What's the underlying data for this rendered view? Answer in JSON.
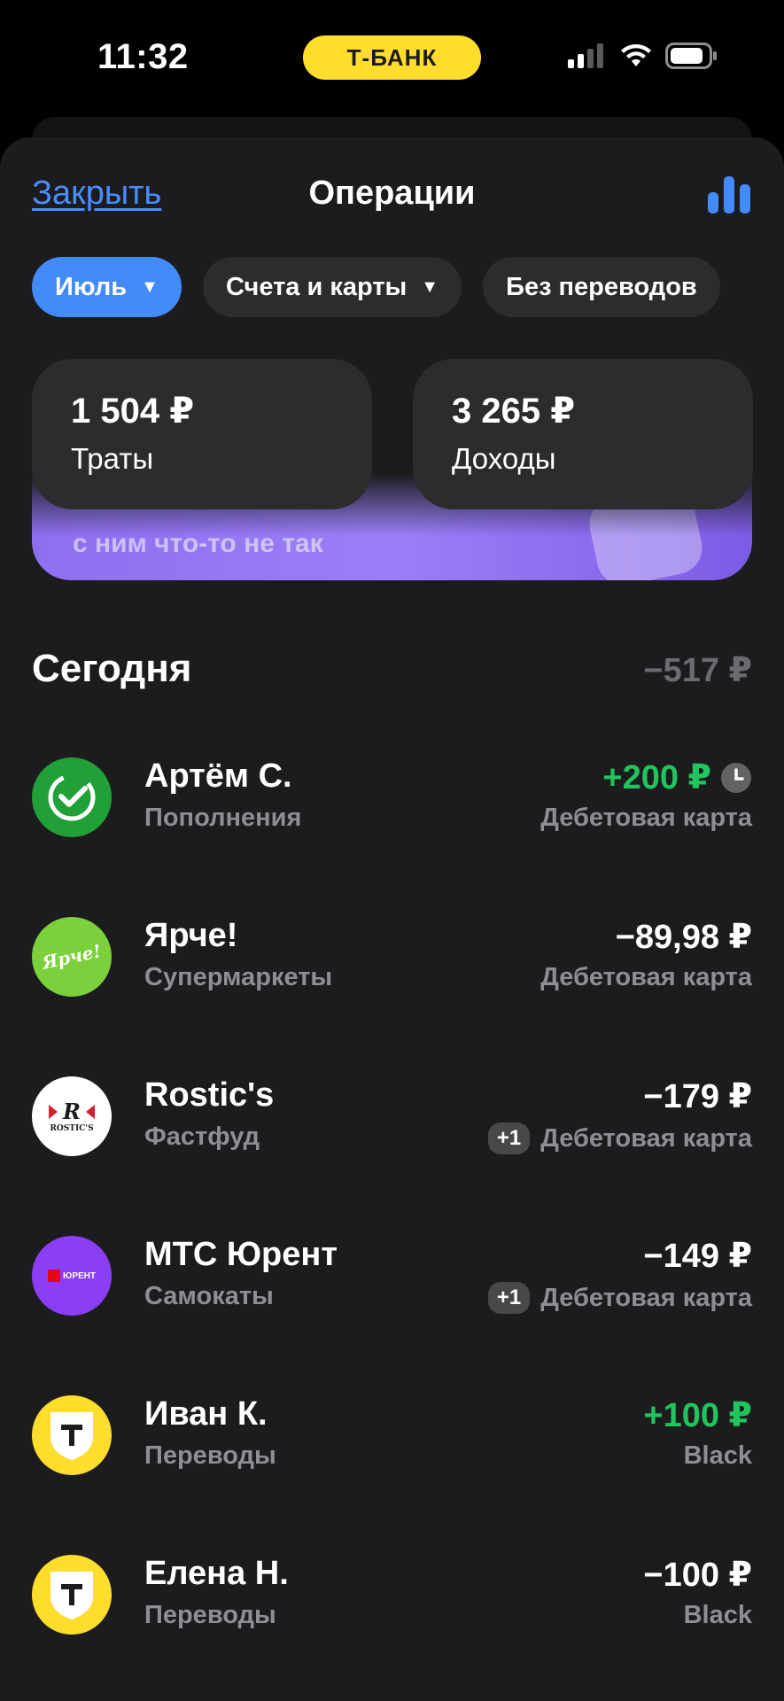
{
  "status_bar": {
    "time": "11:32",
    "bank_name": "Т-БАНК",
    "icons": [
      "signal-icon",
      "wifi-icon",
      "battery-icon"
    ]
  },
  "header": {
    "close_label": "Закрыть",
    "title": "Операции",
    "analytics_icon": "bar-chart-icon"
  },
  "filters": [
    {
      "label": "Июль",
      "selected": true,
      "has_dropdown": true
    },
    {
      "label": "Счета и карты",
      "selected": false,
      "has_dropdown": true
    },
    {
      "label": "Без переводов",
      "selected": false,
      "has_dropdown": false
    }
  ],
  "totals": {
    "spending": {
      "amount": "1 504 ₽",
      "label": "Траты"
    },
    "income": {
      "amount": "3 265 ₽",
      "label": "Доходы"
    }
  },
  "promo": {
    "text": "с ним что-то не так"
  },
  "day": {
    "title": "Сегодня",
    "sum": "−517 ₽"
  },
  "operations": [
    {
      "name": "Артём С.",
      "category": "Пополнения",
      "amount": "+200 ₽",
      "account": "Дебетовая карта",
      "positive": true,
      "pending": true,
      "badge": ""
    },
    {
      "name": "Ярче!",
      "category": "Супермаркеты",
      "amount": "−89,98 ₽",
      "account": "Дебетовая карта",
      "positive": false,
      "pending": false,
      "badge": "",
      "logo_text": "Ярче!"
    },
    {
      "name": "Rostic's",
      "category": "Фастфуд",
      "amount": "−179 ₽",
      "account": "Дебетовая карта",
      "positive": false,
      "pending": false,
      "badge": "+1",
      "logo_text": "ROSTIC'S"
    },
    {
      "name": "МТС Юрент",
      "category": "Самокаты",
      "amount": "−149 ₽",
      "account": "Дебетовая карта",
      "positive": false,
      "pending": false,
      "badge": "+1",
      "logo_text": "ЮРЕНТ"
    },
    {
      "name": "Иван К.",
      "category": "Переводы",
      "amount": "+100 ₽",
      "account": "Black",
      "positive": true,
      "pending": false,
      "badge": ""
    },
    {
      "name": "Елена Н.",
      "category": "Переводы",
      "amount": "−100 ₽",
      "account": "Black",
      "positive": false,
      "pending": false,
      "badge": ""
    }
  ],
  "colors": {
    "accent_blue": "#428bf9",
    "income_green": "#21c55d",
    "brand_yellow": "#ffdd2d",
    "sber_green": "#21a038",
    "yarche_green": "#7cd03b",
    "yurent_purple": "#8b3ff5",
    "background": "#1c1c1e",
    "card": "#2c2c2e"
  }
}
